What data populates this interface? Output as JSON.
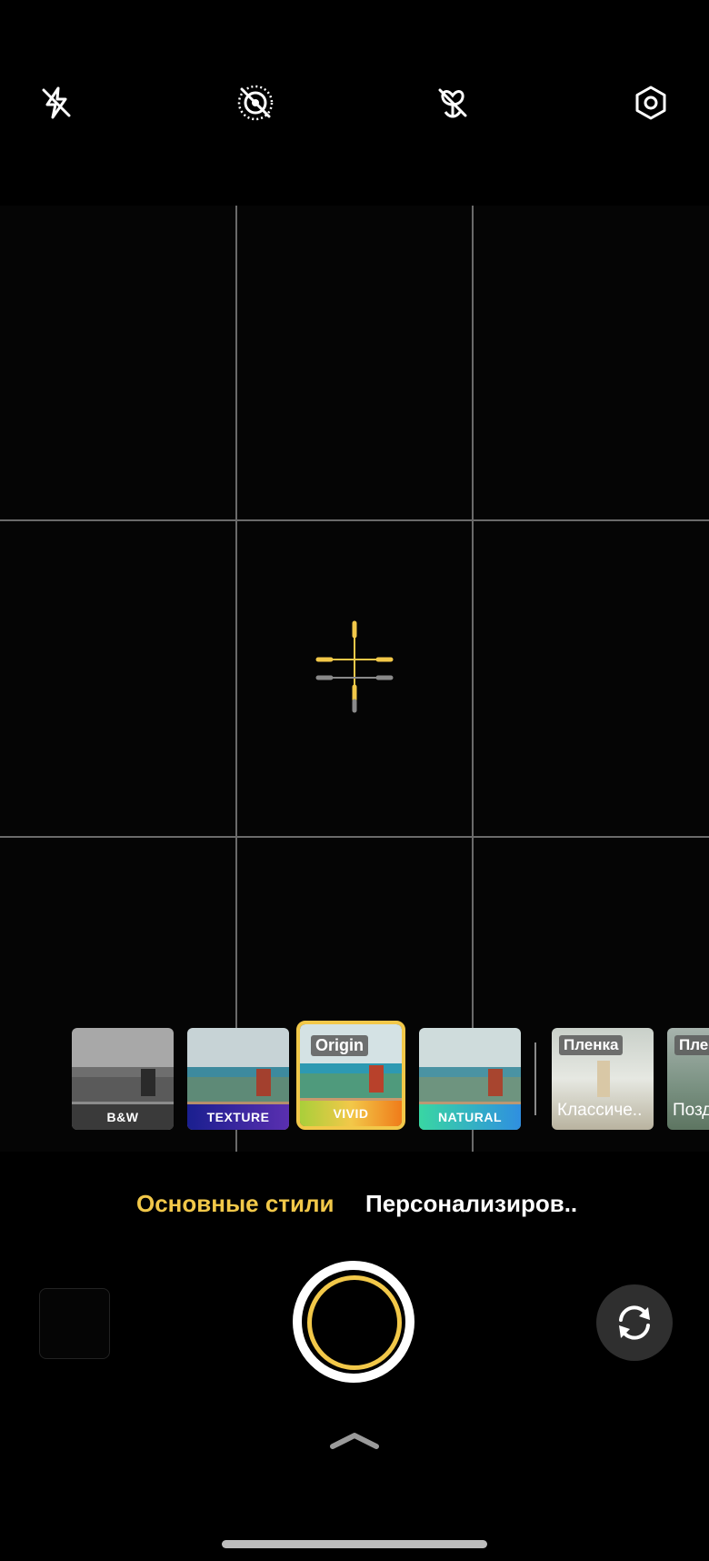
{
  "top_bar": {
    "icons": [
      "flash-off-icon",
      "live-photo-off-icon",
      "macro-off-icon",
      "settings-icon"
    ]
  },
  "viewfinder": {
    "grid": "3x3",
    "focus_indicator": "crosshair-level-icon"
  },
  "filters": [
    {
      "id": "bw",
      "label": "B&W",
      "tag": "",
      "caption": "",
      "selected": false
    },
    {
      "id": "texture",
      "label": "TEXTURE",
      "tag": "",
      "caption": "",
      "selected": false
    },
    {
      "id": "vivid",
      "label": "VIVID",
      "tag": "Origin",
      "caption": "",
      "selected": true
    },
    {
      "id": "natural",
      "label": "NATURAL",
      "tag": "",
      "caption": "",
      "selected": false
    },
    {
      "id": "classic",
      "label": "",
      "tag": "Пленка",
      "caption": "Классиче..",
      "selected": false
    },
    {
      "id": "late",
      "label": "",
      "tag": "Пле",
      "caption": "Позд",
      "selected": false
    }
  ],
  "tabs": [
    {
      "label": "Основные стили",
      "active": true
    },
    {
      "label": "Персонализиров..",
      "active": false
    }
  ],
  "bottom": {
    "shutter": "shutter-button",
    "switch_camera": "switch-camera-icon",
    "expand": "chevron-up-icon"
  },
  "colors": {
    "accent": "#f2c849",
    "background": "#000000",
    "grid": "#6a6a6a"
  }
}
